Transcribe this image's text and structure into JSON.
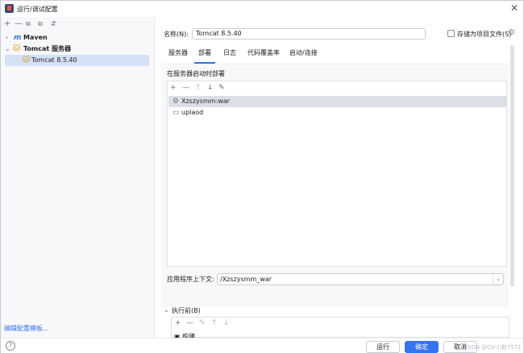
{
  "window": {
    "title": "运行/调试配置",
    "close": "✕"
  },
  "left": {
    "toolbar": [
      "+",
      "—",
      "⧉",
      "⧉",
      "⇵"
    ],
    "tree": {
      "maven": "Maven",
      "maven_icon": "m",
      "tomcat_group": "Tomcat 服务器",
      "tomcat_item": "Tomcat 8.5.40"
    },
    "edit_templates": "编辑配置模板..."
  },
  "form": {
    "name_label": "名称(N):",
    "name_value": "Tomcat 8.5.40",
    "store_as_file": "存储为项目文件(S)",
    "tabs": [
      "服务器",
      "部署",
      "日志",
      "代码覆盖率",
      "启动/连接"
    ],
    "active_tab": "部署"
  },
  "deploy": {
    "section_title": "在服务器启动时部署",
    "toolbar": [
      "+",
      "—",
      "↑",
      "↓",
      "✎"
    ],
    "items": [
      {
        "name": "Xzszysmm:war",
        "icon": "artifact-icon",
        "selected": true
      },
      {
        "name": "uplaod",
        "icon": "folder-icon",
        "selected": false
      }
    ],
    "context_label": "应用程序上下文:",
    "context_value": "/Xzszysmm_war"
  },
  "before_launch": {
    "title": "执行前(B)",
    "toolbar": [
      "+",
      "—",
      "✎",
      "↑",
      "↓"
    ],
    "build_item": "构建"
  },
  "buttons": {
    "help": "?",
    "run": "运行",
    "ok": "确定",
    "cancel": "取消"
  },
  "watermark": "CSDN @Ctr小新7571",
  "colors": {
    "accent": "#3574f0",
    "selection": "#d5e1f5"
  }
}
